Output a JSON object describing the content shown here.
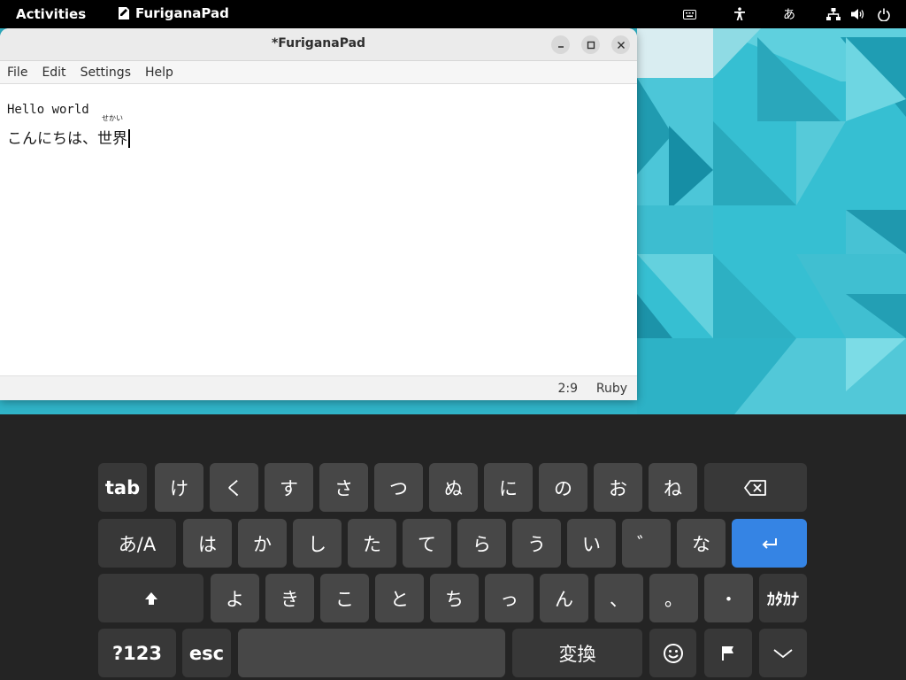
{
  "topbar": {
    "activities": "Activities",
    "app_name": "FuriganaPad",
    "ime_indicator": "あ",
    "icons": [
      "keyboard-icon",
      "accessibility-icon",
      "network-icon",
      "volume-icon",
      "power-icon"
    ]
  },
  "window": {
    "title": "*FuriganaPad",
    "menu": [
      "File",
      "Edit",
      "Settings",
      "Help"
    ],
    "editor": {
      "line1": "Hello world",
      "line2_prefix": "こんにちは、",
      "ruby_base": "世界",
      "ruby_text": "せかい"
    },
    "status": {
      "position": "2:9",
      "mode": "Ruby"
    }
  },
  "keyboard": {
    "row1": [
      "tab",
      "け",
      "く",
      "す",
      "さ",
      "つ",
      "ぬ",
      "に",
      "の",
      "お",
      "ね"
    ],
    "row2": [
      "あ/A",
      "は",
      "か",
      "し",
      "た",
      "て",
      "ら",
      "う",
      "い",
      "゛",
      "な"
    ],
    "row3": [
      "よ",
      "き",
      "こ",
      "と",
      "ち",
      "っ",
      "ん",
      "、",
      "。",
      "・",
      "ｶﾀｶﾅ"
    ],
    "row4": [
      "?123",
      "esc",
      "",
      "変換"
    ],
    "icons": [
      "backspace-icon",
      "enter-icon",
      "shift-icon",
      "emoji-icon",
      "flag-icon",
      "hide-keyboard-icon"
    ]
  },
  "colors": {
    "wallpaper": "#2fb2c7",
    "enter_key": "#3584e4",
    "key": "#474747",
    "keyboard_bg": "#242424"
  }
}
